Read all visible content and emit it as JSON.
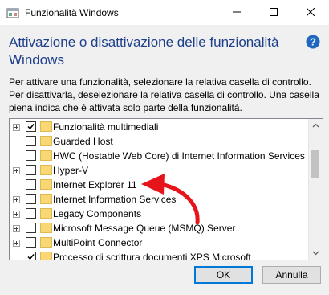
{
  "window": {
    "title": "Funzionalità Windows",
    "minimize_icon": "minimize-icon",
    "maximize_icon": "maximize-icon",
    "close_icon": "close-icon"
  },
  "heading": "Attivazione o disattivazione delle funzionalità Windows",
  "description": "Per attivare una funzionalità, selezionare la relativa casella di controllo. Per disattivarla, deselezionare la relativa casella di controllo. Una casella piena indica che è attivata solo parte della funzionalità.",
  "features": [
    {
      "label": "Funzionalità multimediali",
      "expandable": true,
      "state": "checked"
    },
    {
      "label": "Guarded Host",
      "expandable": false,
      "state": "unchecked"
    },
    {
      "label": "HWC (Hostable Web Core) di Internet Information Services",
      "expandable": false,
      "state": "unchecked"
    },
    {
      "label": "Hyper-V",
      "expandable": true,
      "state": "unchecked"
    },
    {
      "label": "Internet Explorer 11",
      "expandable": false,
      "state": "unchecked"
    },
    {
      "label": "Internet Information Services",
      "expandable": true,
      "state": "unchecked"
    },
    {
      "label": "Legacy Components",
      "expandable": true,
      "state": "unchecked"
    },
    {
      "label": "Microsoft Message Queue (MSMQ) Server",
      "expandable": true,
      "state": "unchecked"
    },
    {
      "label": "MultiPoint Connector",
      "expandable": true,
      "state": "unchecked"
    },
    {
      "label": "Processo di scrittura documenti XPS Microsoft",
      "expandable": false,
      "state": "checked"
    }
  ],
  "buttons": {
    "ok": "OK",
    "cancel": "Annulla"
  },
  "colors": {
    "heading": "#1e3f8a",
    "accent": "#0078d7",
    "annotation_arrow": "#e8141c",
    "folder": "#f8d775"
  }
}
